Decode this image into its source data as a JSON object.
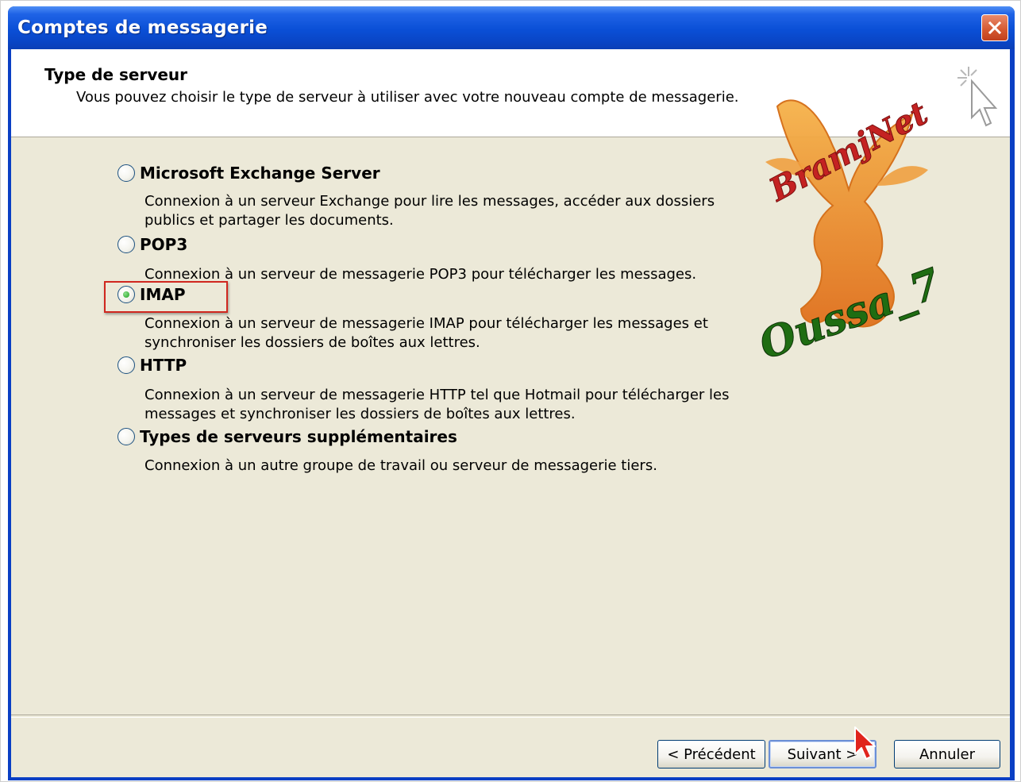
{
  "window": {
    "title": "Comptes de messagerie"
  },
  "header": {
    "title": "Type de serveur",
    "description": "Vous pouvez choisir le type de serveur à utiliser avec votre nouveau compte de messagerie."
  },
  "options": [
    {
      "label": "Microsoft Exchange Server",
      "description": "Connexion à un serveur Exchange pour lire les messages, accéder aux dossiers publics et partager les documents.",
      "selected": false
    },
    {
      "label": "POP3",
      "description": "Connexion à un serveur de messagerie POP3 pour télécharger les messages.",
      "selected": false
    },
    {
      "label": "IMAP",
      "description": "Connexion à un serveur de messagerie IMAP pour télécharger les messages et synchroniser les dossiers de boîtes aux lettres.",
      "selected": true
    },
    {
      "label": "HTTP",
      "description": "Connexion à un serveur de messagerie HTTP tel que Hotmail pour télécharger les messages et synchroniser les dossiers de boîtes aux lettres.",
      "selected": false
    },
    {
      "label": "Types de serveurs supplémentaires",
      "description": "Connexion à un autre groupe de travail ou serveur de messagerie tiers.",
      "selected": false
    }
  ],
  "buttons": {
    "back": "< Précédent",
    "next": "Suivant >",
    "cancel": "Annuler"
  },
  "watermark": {
    "line1": "BramjNet",
    "line2": "Oussa_7"
  },
  "colors": {
    "titlebar": "#0a4fd6",
    "dialog": "#ece9d8",
    "highlight": "#d0271f",
    "close": "#d4572f"
  },
  "icons": {
    "close": "close-icon",
    "wizard": "magic-cursor-icon",
    "pointer": "mouse-pointer-icon"
  }
}
